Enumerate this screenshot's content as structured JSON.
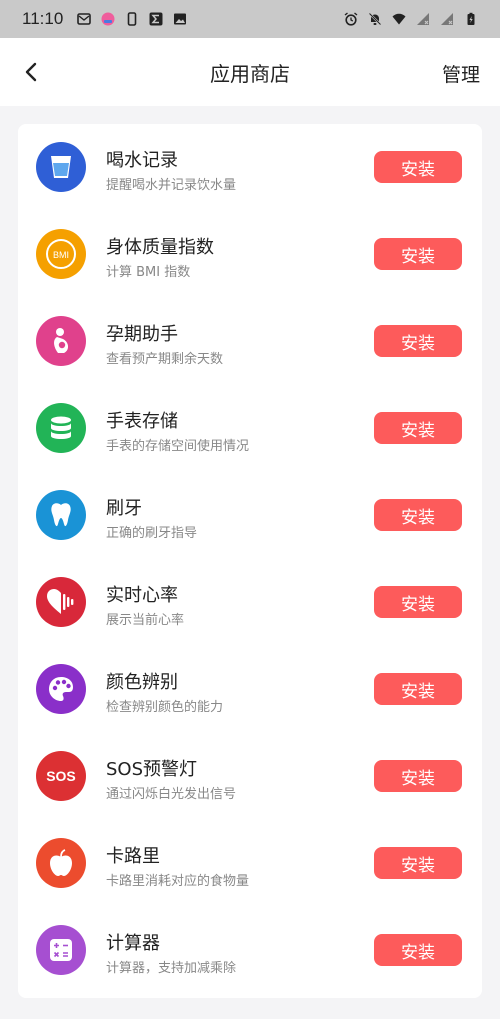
{
  "status_bar": {
    "time": "11:10"
  },
  "header": {
    "title": "应用商店",
    "manage_label": "管理"
  },
  "apps": [
    {
      "name": "喝水记录",
      "desc": "提醒喝水并记录饮水量",
      "install": "安装",
      "icon": "water-cup-icon",
      "color": "#2f5fd6"
    },
    {
      "name": "身体质量指数",
      "desc": "计算 BMI 指数",
      "install": "安装",
      "icon": "bmi-gauge-icon",
      "color": "#f5a000",
      "icon_text": "BMI"
    },
    {
      "name": "孕期助手",
      "desc": "查看预产期剩余天数",
      "install": "安装",
      "icon": "pregnancy-icon",
      "color": "#e0418c"
    },
    {
      "name": "手表存储",
      "desc": "手表的存储空间使用情况",
      "install": "安装",
      "icon": "database-icon",
      "color": "#22b457"
    },
    {
      "name": "刷牙",
      "desc": "正确的刷牙指导",
      "install": "安装",
      "icon": "tooth-icon",
      "color": "#1a93d6"
    },
    {
      "name": "实时心率",
      "desc": "展示当前心率",
      "install": "安装",
      "icon": "heart-rate-icon",
      "color": "#d8283a"
    },
    {
      "name": "颜色辨别",
      "desc": "检查辨别颜色的能力",
      "install": "安装",
      "icon": "palette-icon",
      "color": "#8a2fc9"
    },
    {
      "name": "SOS预警灯",
      "desc": "通过闪烁白光发出信号",
      "install": "安装",
      "icon": "sos-icon",
      "color": "#dc3033",
      "icon_text": "SOS"
    },
    {
      "name": "卡路里",
      "desc": "卡路里消耗对应的食物量",
      "install": "安装",
      "icon": "apple-icon",
      "color": "#ec4c2e"
    },
    {
      "name": "计算器",
      "desc": "计算器，支持加减乘除",
      "install": "安装",
      "icon": "calculator-icon",
      "color": "#a64fd1"
    }
  ]
}
